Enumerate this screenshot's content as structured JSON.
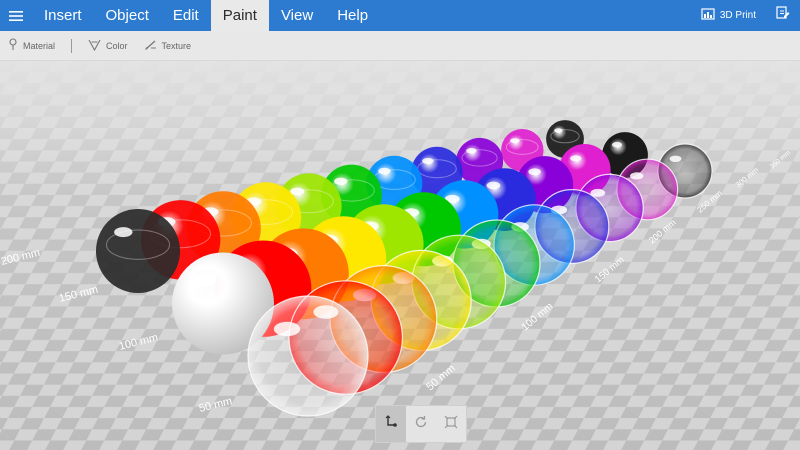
{
  "menu": {
    "items": [
      {
        "label": "Insert",
        "active": false
      },
      {
        "label": "Object",
        "active": false
      },
      {
        "label": "Edit",
        "active": false
      },
      {
        "label": "Paint",
        "active": true
      },
      {
        "label": "View",
        "active": false
      },
      {
        "label": "Help",
        "active": false
      }
    ],
    "print_label": "3D Print"
  },
  "toolbar": {
    "material_label": "Material",
    "color_label": "Color",
    "texture_label": "Texture"
  },
  "scene": {
    "ruler_left": [
      "50 mm",
      "100 mm",
      "150 mm",
      "200 mm"
    ],
    "ruler_right": [
      "50 mm",
      "100 mm",
      "150 mm",
      "200 mm",
      "250 mm",
      "300 mm",
      "350 mm"
    ],
    "sphere_colors": [
      "#ffffff",
      "#ff0000",
      "#ff7a00",
      "#ffe800",
      "#9ee600",
      "#00c800",
      "#0090ff",
      "#2a2adf",
      "#8a00d8",
      "#e020d0",
      "#1a1a1a"
    ]
  }
}
